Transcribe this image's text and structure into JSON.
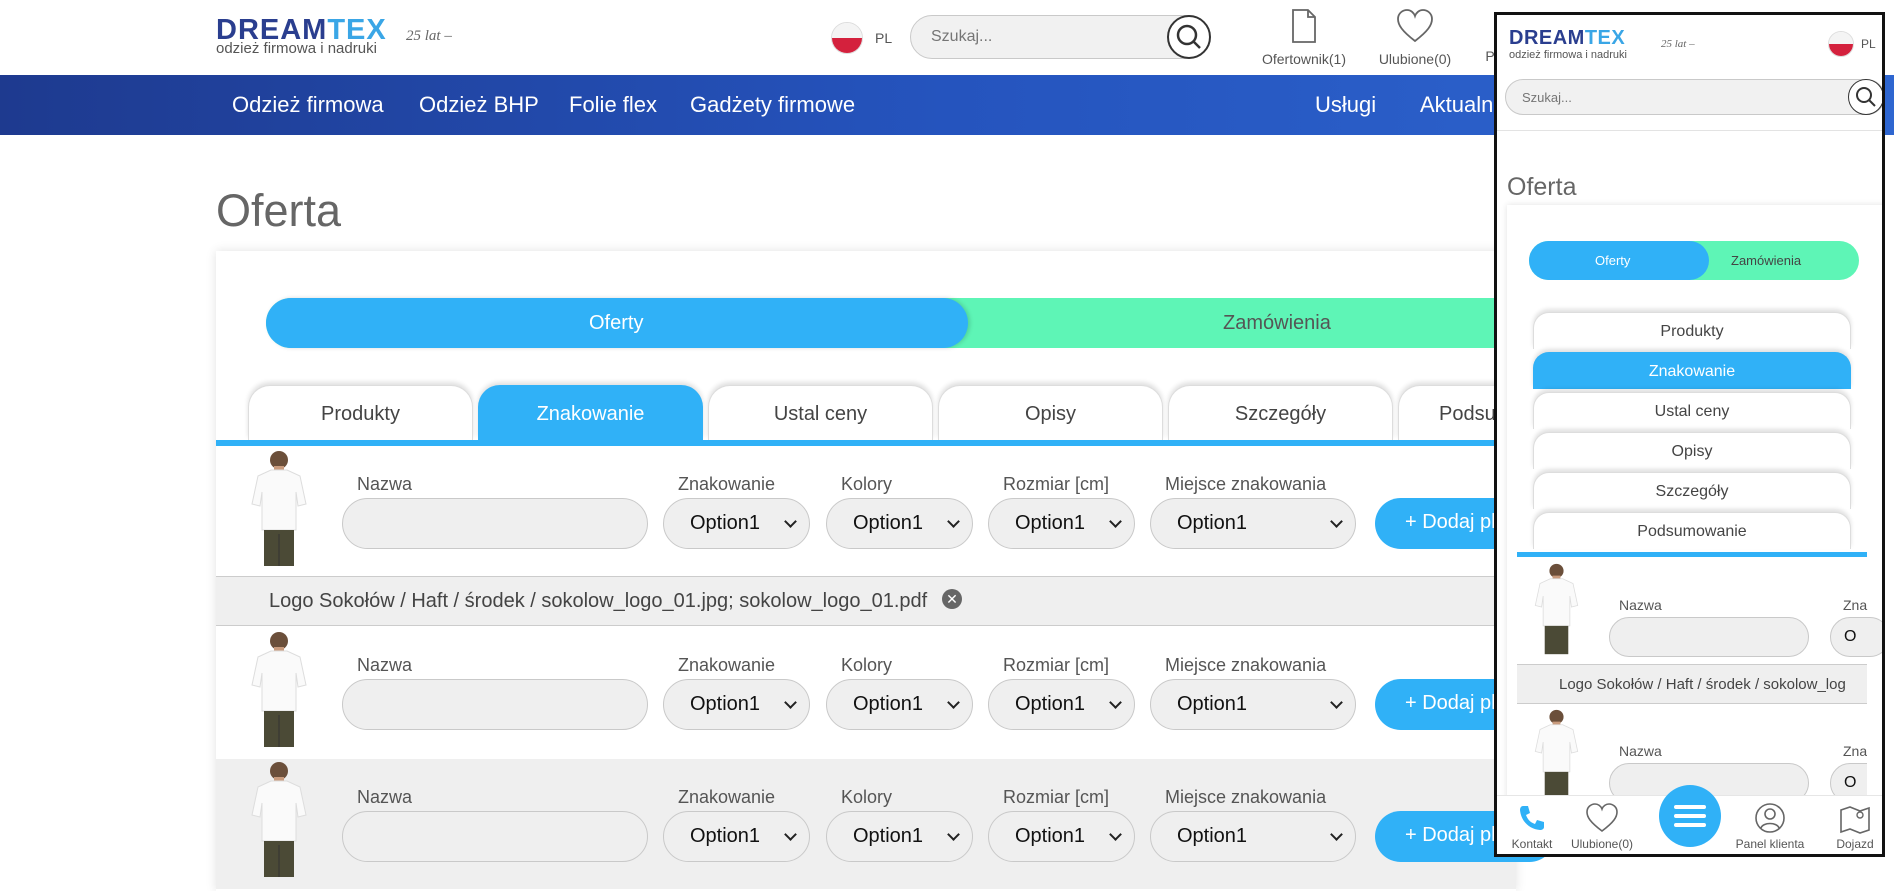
{
  "header": {
    "logo_dream": "DREAM",
    "logo_tex": "TEX",
    "logo_tagline": "odzież firmowa i nadruki",
    "logo_years": "25 lat –",
    "lang": "PL",
    "search_placeholder": "Szukaj...",
    "links": {
      "ofertownik": "Ofertownik(1)",
      "ulubione": "Ulubione(0)",
      "partial": "P"
    }
  },
  "nav": {
    "items": [
      "Odzież firmowa",
      "Odzież BHP",
      "Folie flex",
      "Gadżety firmowe"
    ],
    "right_items": [
      "Usługi",
      "Aktualn"
    ]
  },
  "page": {
    "title": "Oferta",
    "segments": [
      "Oferty",
      "Zamówienia"
    ],
    "tabs": [
      "Produkty",
      "Znakowanie",
      "Ustal ceny",
      "Opisy",
      "Szczegóły",
      "Podsu"
    ],
    "active_tab": "Znakowanie",
    "field_labels": {
      "nazwa": "Nazwa",
      "znakowanie": "Znakowanie",
      "kolory": "Kolory",
      "rozmiar": "Rozmiar [cm]",
      "miejsce": "Miejsce znakowania"
    },
    "select_value": "Option1",
    "add_button": "+ Dodaj pl",
    "logo_line": "Logo Sokołów / Haft / środek / sokolow_logo_01.jpg; sokolow_logo_01.pdf",
    "close_glyph": "✕"
  },
  "mobile": {
    "logo_dream": "DREAM",
    "logo_tex": "TEX",
    "logo_tagline": "odzież firmowa i nadruki",
    "logo_years": "25 lat –",
    "lang": "PL",
    "search_placeholder": "Szukaj...",
    "title": "Oferta",
    "segments": [
      "Oferty",
      "Zamówienia"
    ],
    "tabs": [
      "Produkty",
      "Znakowanie",
      "Ustal ceny",
      "Opisy",
      "Szczegóły",
      "Podsumowanie"
    ],
    "field_labels": {
      "nazwa": "Nazwa",
      "zna": "Zna"
    },
    "select_partial": "O",
    "logo_line": "Logo Sokołów / Haft / środek / sokolow_log",
    "bottom": [
      "Kontakt",
      "Ulubione(0)",
      "Panel klienta",
      "Dojazd"
    ]
  },
  "colors": {
    "nav": "#2554be",
    "accent_blue": "#30b1f7",
    "accent_green": "#5ef5b6"
  }
}
